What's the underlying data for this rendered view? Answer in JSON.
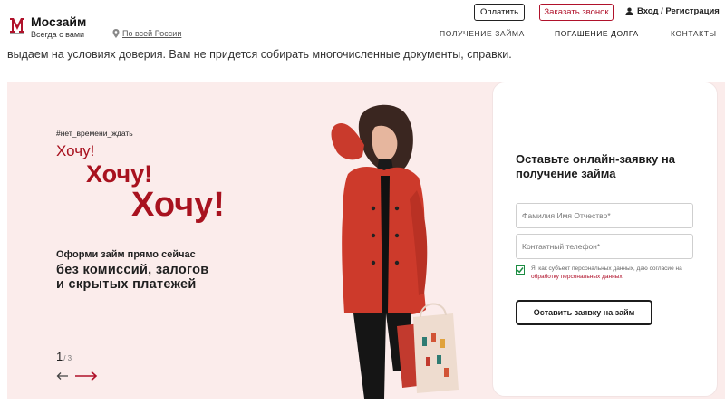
{
  "header": {
    "brand_name": "Мосзайм",
    "brand_tagline": "Всегда с вами",
    "region_link": "По всей России",
    "pay_button": "Оплатить",
    "call_button": "Заказать звонок",
    "login_link": "Вход / Регистрация",
    "nav": [
      "ПОЛУЧЕНИЕ ЗАЙМА",
      "ПОГАШЕНИЕ ДОЛГА",
      "КОНТАКТЫ"
    ],
    "accent_color": "#b0122b"
  },
  "intro_text": "выдаем на условиях доверия. Вам не придется собирать многочисленные документы, справки.",
  "hero": {
    "hashtag": "#нет_времени_ждать",
    "want_1": "Хочу!",
    "want_2": "Хочу!",
    "want_3": "Хочу!",
    "offer_line_1": "Оформи займ прямо сейчас",
    "offer_line_2": "без комиссий, залогов",
    "offer_line_3": "и скрытых платежей",
    "slide_current": "1",
    "slide_total": "/ 3",
    "background_color": "#fbeceb"
  },
  "form": {
    "title": "Оставьте онлайн-заявку на получение займа",
    "name_placeholder": "Фамилия Имя Отчество*",
    "phone_placeholder": "Контактный телефон*",
    "consent_checked": true,
    "consent_text": "Я, как субъект персональных данных, даю согласие на ",
    "consent_link": "обработку персональных данных",
    "submit_label": "Оставить заявку на займ"
  }
}
